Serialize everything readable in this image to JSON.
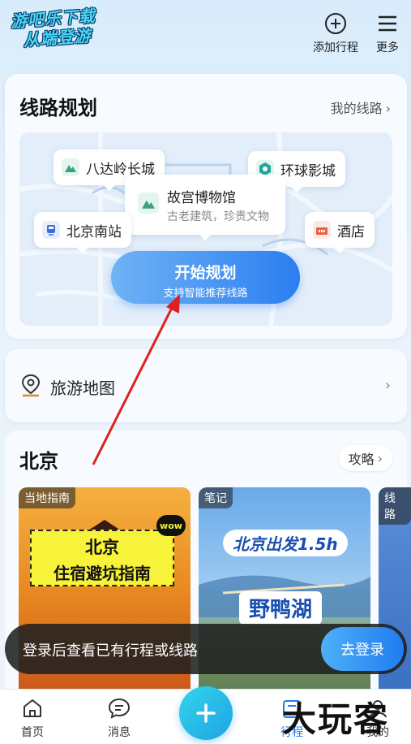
{
  "header": {
    "watermark_line1": "游吧乐下载",
    "watermark_line2": "从端登游",
    "add_trip_label": "添加行程",
    "more_label": "更多"
  },
  "route_planning": {
    "title": "线路规划",
    "my_routes_link": "我的线路",
    "pois": {
      "badaling": "八达岭长城",
      "universal": "环球影城",
      "palace_museum": "故宫博物馆",
      "palace_museum_sub": "古老建筑，珍贵文物",
      "beijing_south": "北京南站",
      "hotel": "酒店"
    },
    "start_button": "开始规划",
    "start_button_sub": "支持智能推荐线路"
  },
  "travel_map": {
    "label": "旅游地图"
  },
  "city": {
    "name": "北京",
    "guide_button": "攻略",
    "cards": [
      {
        "tag": "当地指南",
        "line1": "北京",
        "line2": "住宿避坑指南",
        "badge": "wow"
      },
      {
        "tag": "笔记",
        "line1": "北京出发1.5h",
        "line2": "野鸭湖"
      },
      {
        "tag": "线路"
      }
    ]
  },
  "login_toast": {
    "message": "登录后查看已有行程或线路",
    "button": "去登录"
  },
  "tabbar": {
    "home": "首页",
    "messages": "消息",
    "trip": "行程",
    "mine": "我的"
  },
  "brand_watermark": "大玩客",
  "colors": {
    "accent": "#1f7cef",
    "fab": "#1fa3e6",
    "annotation_arrow": "#e02020"
  }
}
